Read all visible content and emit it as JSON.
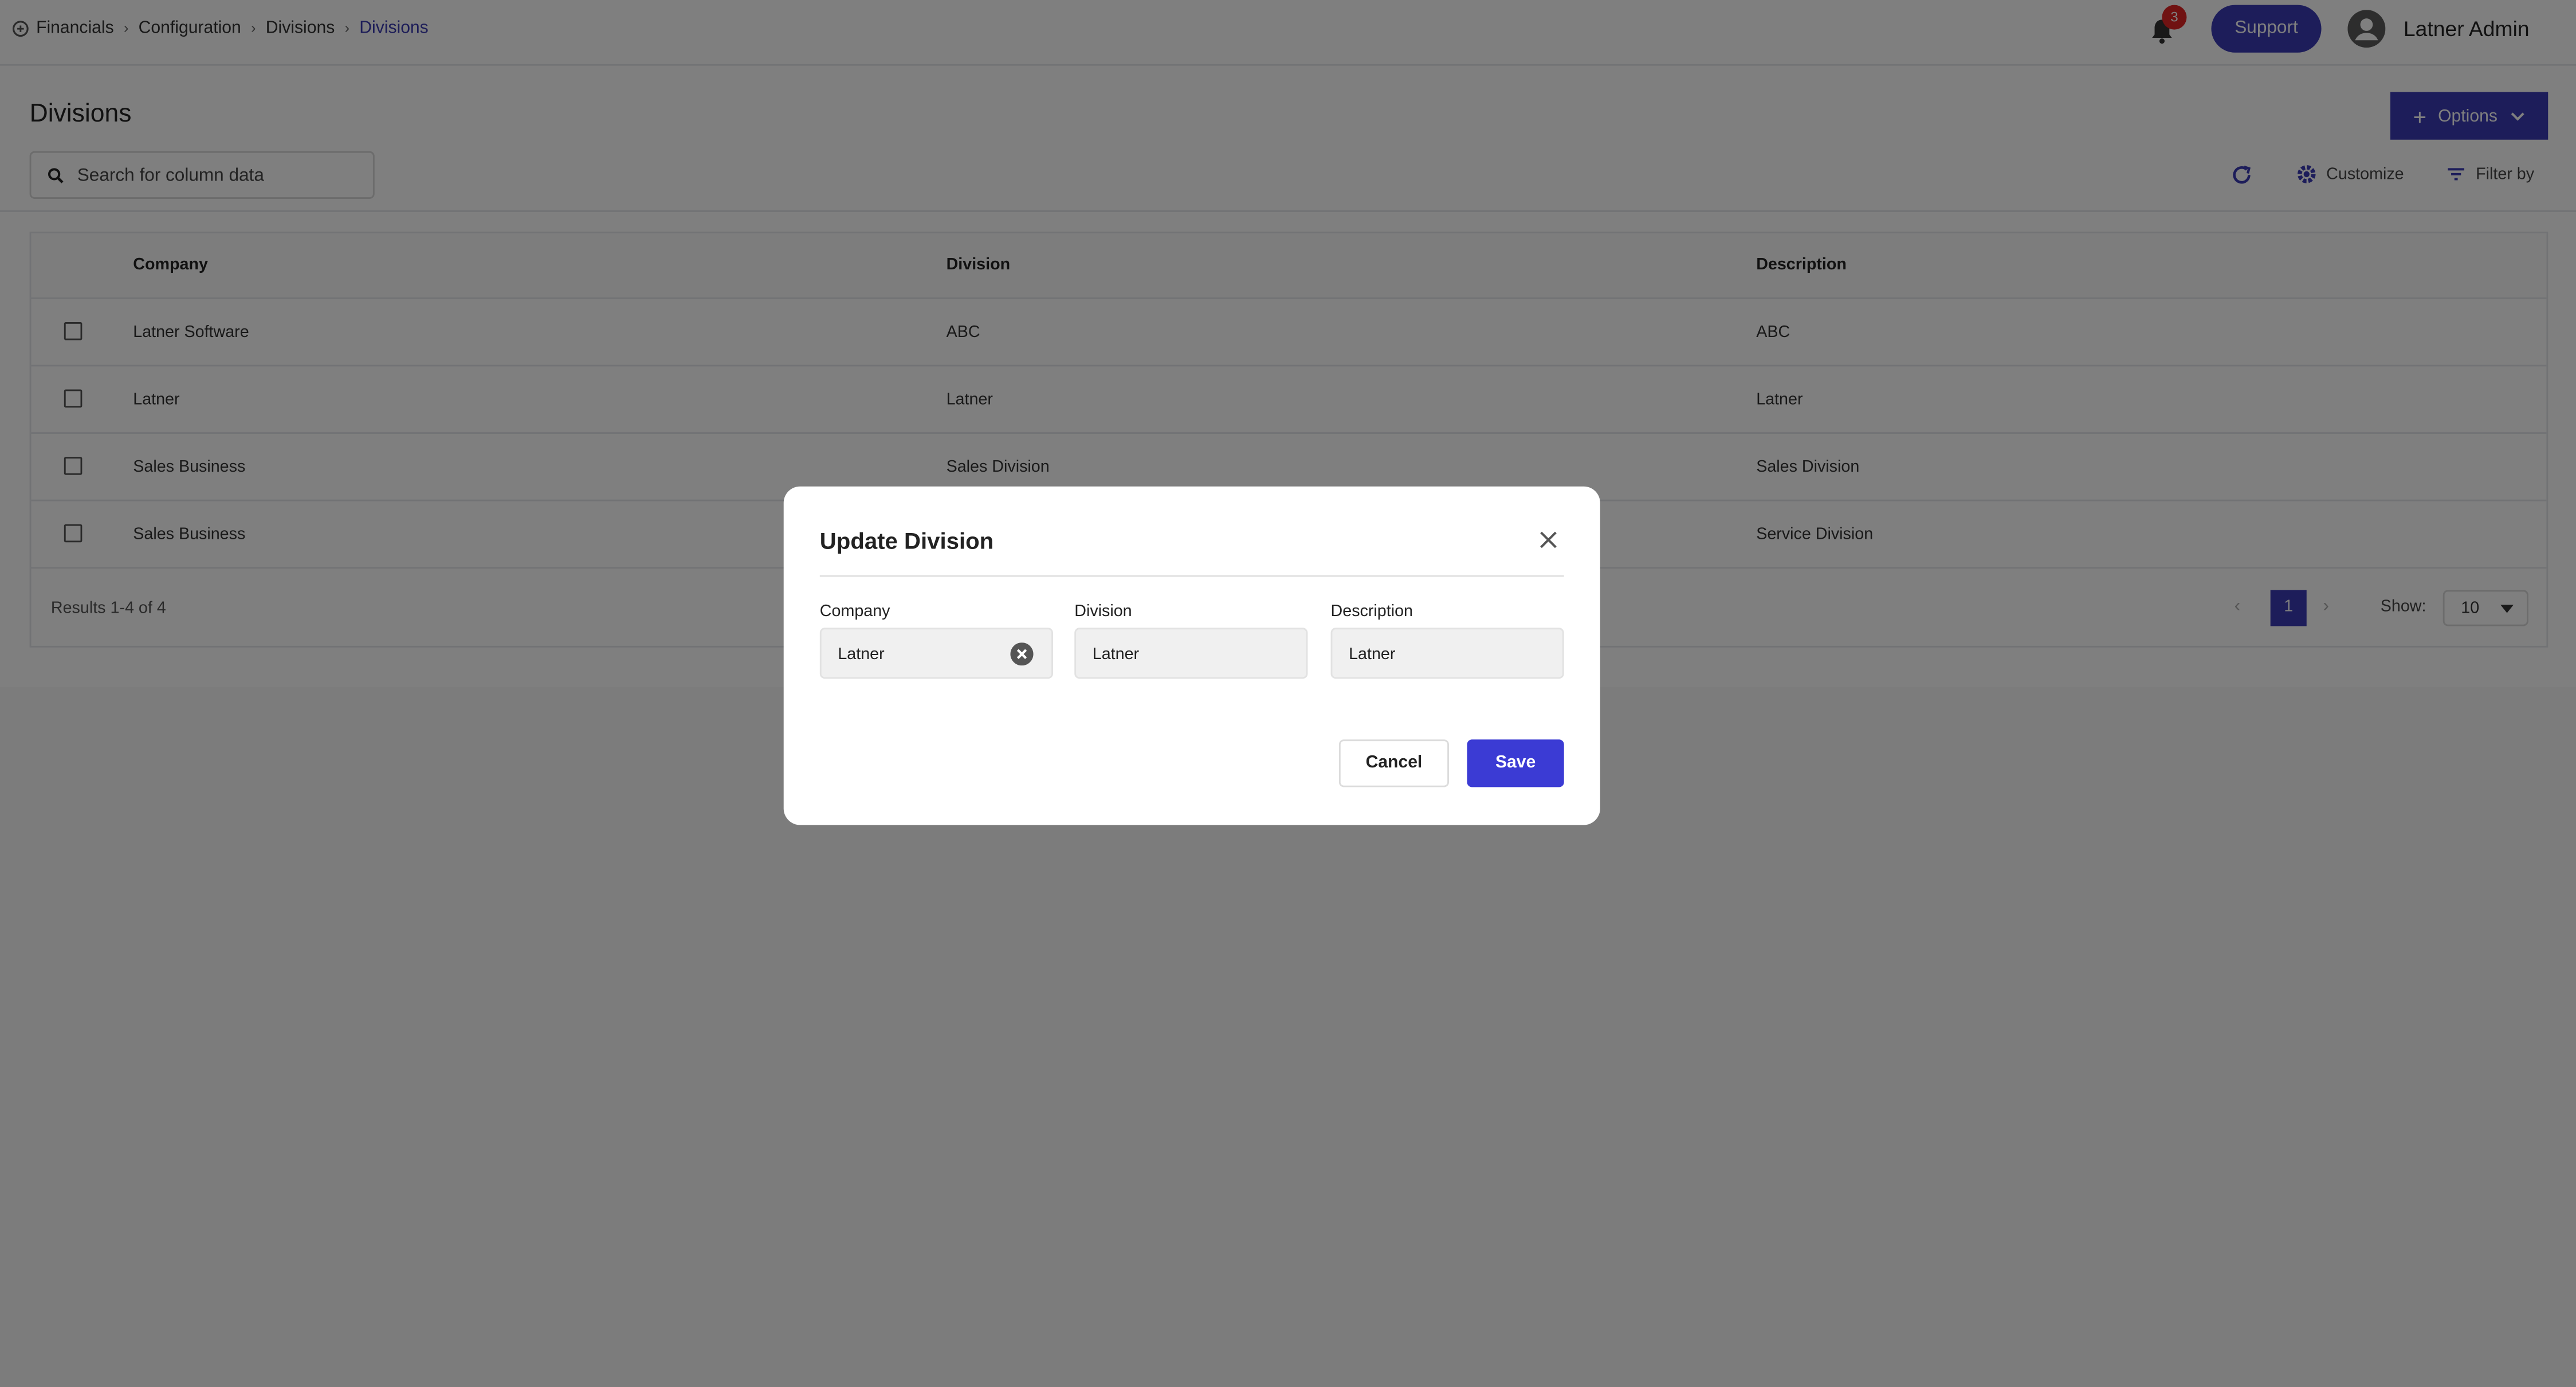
{
  "breadcrumb": {
    "items": [
      "Financials",
      "Configuration",
      "Divisions"
    ],
    "current": "Divisions",
    "icon": "financials-icon"
  },
  "header": {
    "notifications_count": "3",
    "support_label": "Support",
    "user_name": "Latner Admin"
  },
  "page": {
    "title": "Divisions",
    "options_label": "Options"
  },
  "toolbar": {
    "search_placeholder": "Search for column data",
    "customize_label": "Customize",
    "filter_label": "Filter by"
  },
  "table": {
    "columns": [
      "Company",
      "Division",
      "Description"
    ],
    "rows": [
      {
        "company": "Latner Software",
        "division": "ABC",
        "description": "ABC"
      },
      {
        "company": "Latner",
        "division": "Latner",
        "description": "Latner"
      },
      {
        "company": "Sales Business",
        "division": "Sales Division",
        "description": "Sales Division"
      },
      {
        "company": "Sales Business",
        "division": "",
        "description": "Service Division"
      }
    ],
    "results_text": "Results 1-4 of 4",
    "current_page": "1",
    "show_label": "Show:",
    "page_size": "10"
  },
  "modal": {
    "title": "Update Division",
    "fields": {
      "company_label": "Company",
      "company_value": "Latner",
      "division_label": "Division",
      "division_value": "Latner",
      "description_label": "Description",
      "description_value": "Latner"
    },
    "cancel_label": "Cancel",
    "save_label": "Save"
  },
  "colors": {
    "primary": "#3b3bb5",
    "save": "#3b3bd4",
    "badge": "#e02424",
    "overlay": "rgba(0,0,0,0.5)"
  }
}
